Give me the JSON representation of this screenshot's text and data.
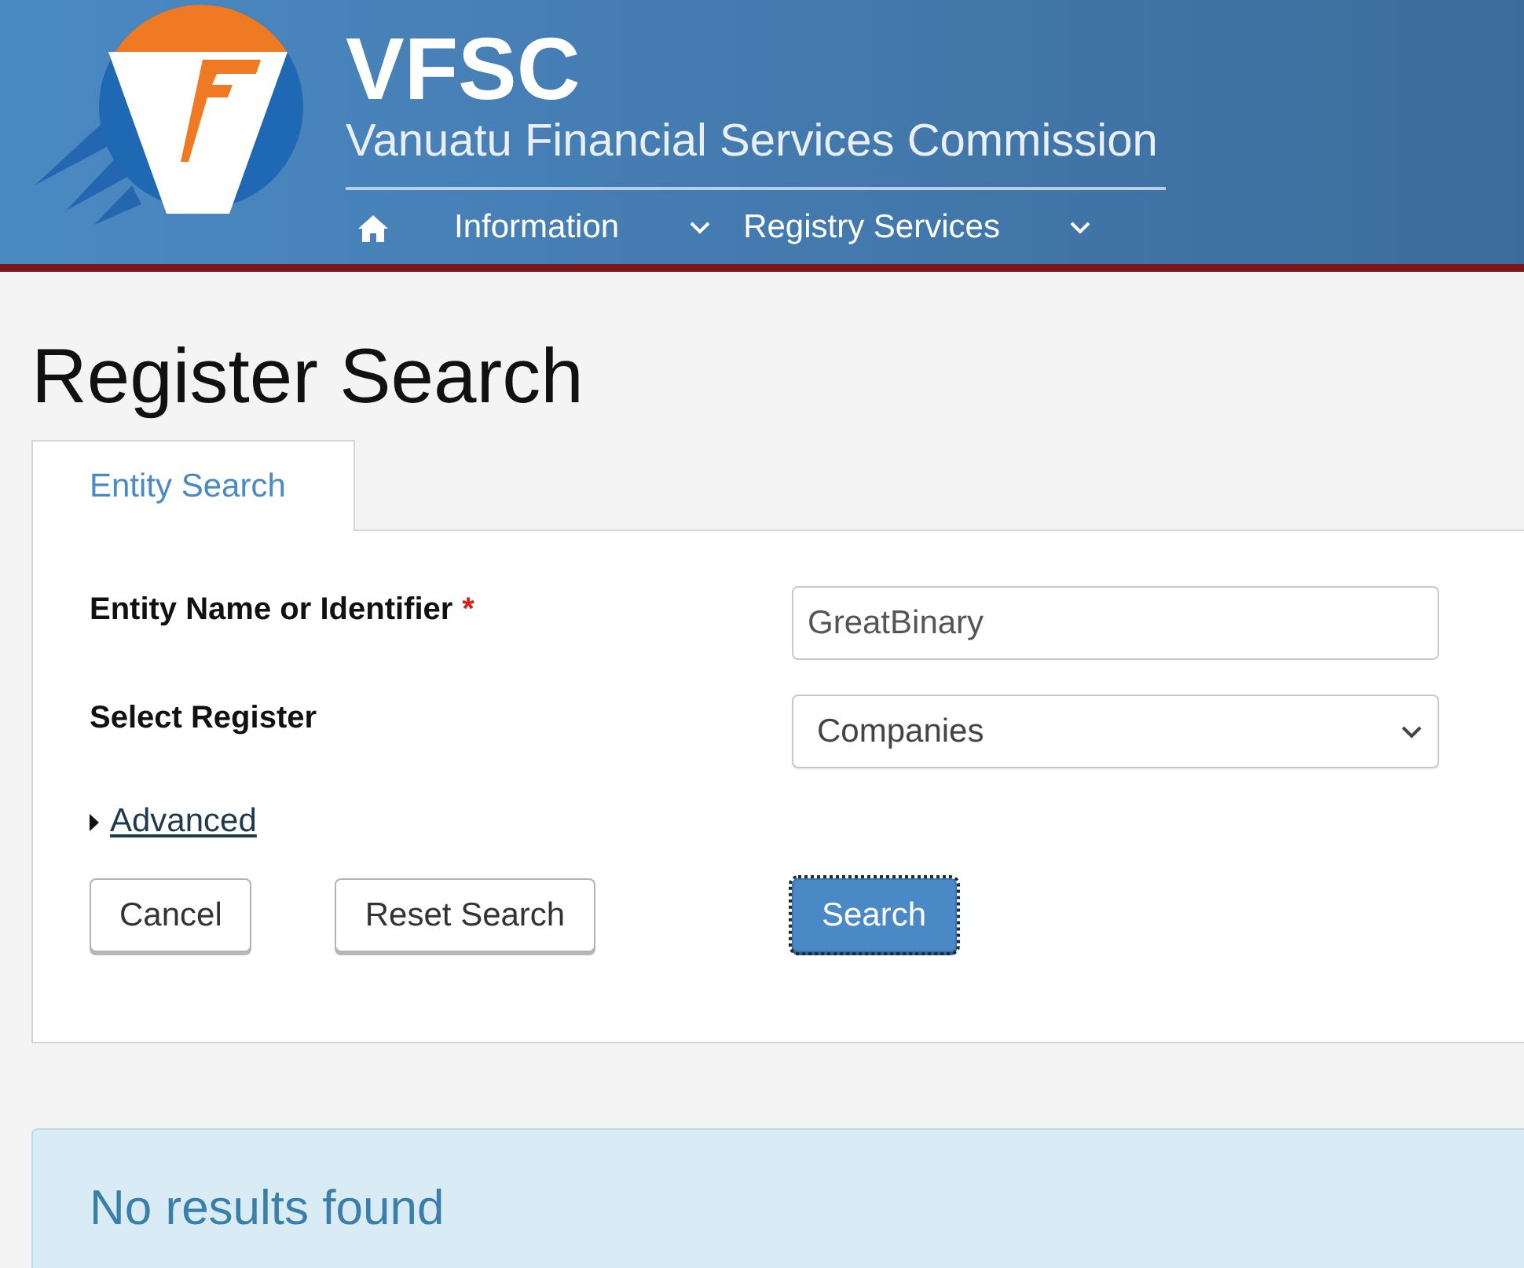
{
  "header": {
    "title": "VFSC",
    "subtitle": "Vanuatu Financial Services Commission",
    "nav": [
      {
        "kind": "home"
      },
      {
        "kind": "dropdown",
        "label": "Information"
      },
      {
        "kind": "dropdown",
        "label": "Registry Services"
      }
    ]
  },
  "page_title": "Register Search",
  "tabs": [
    {
      "label": "Entity Search",
      "selected": true
    }
  ],
  "form": {
    "fields": [
      {
        "kind": "text",
        "label": "Entity Name or Identifier",
        "required_mark": "*",
        "value": "GreatBinary"
      },
      {
        "kind": "select",
        "label": "Select Register",
        "value": "Companies"
      }
    ],
    "advanced": {
      "label": "Advanced",
      "expanded": false
    },
    "buttons": [
      {
        "label": "Cancel",
        "kind": "secondary",
        "focused": false
      },
      {
        "label": "Reset Search",
        "kind": "secondary",
        "focused": false
      },
      {
        "label": "Search",
        "kind": "primary",
        "focused": true
      }
    ]
  },
  "alert": {
    "message": "No results found"
  }
}
